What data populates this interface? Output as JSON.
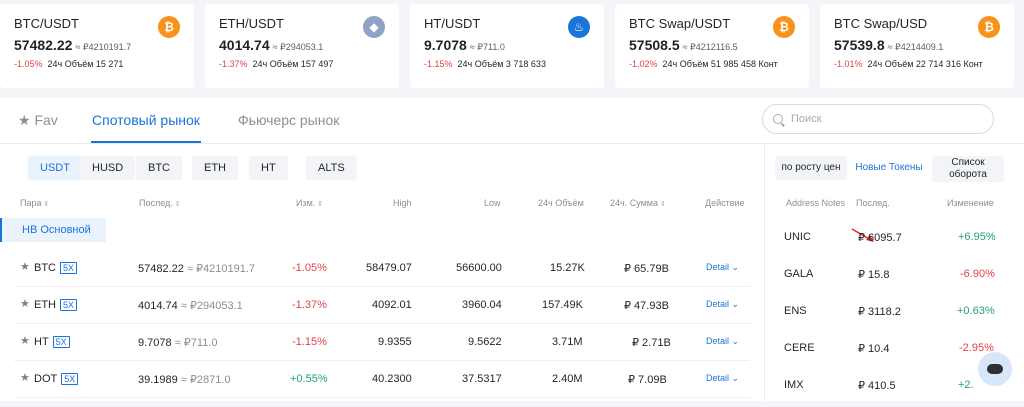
{
  "tickers": [
    {
      "pair": "BTC/USDT",
      "price": "57482.22",
      "conv": "≈ ₽4210191.7",
      "change": "-1.05%",
      "volume": "24ч Объём 15 271",
      "coin": "btc-icon",
      "coin_color": "#f7931a"
    },
    {
      "pair": "ETH/USDT",
      "price": "4014.74",
      "conv": "≈ ₽294053.1",
      "change": "-1.37%",
      "volume": "24ч Объём 157 497",
      "coin": "eth-icon",
      "coin_color": "#8fa3c8"
    },
    {
      "pair": "HT/USDT",
      "price": "9.7078",
      "conv": "≈ ₽711.0",
      "change": "-1.15%",
      "volume": "24ч Объём 3 718 633",
      "coin": "ht-icon",
      "coin_color": "#1a75d8"
    },
    {
      "pair": "BTC Swap/USDT",
      "price": "57508.5",
      "conv": "≈ ₽4212116.5",
      "change": "-1.02%",
      "volume": "24ч Объём 51 985 458 Конт",
      "coin": "btc-icon",
      "coin_color": "#f7931a"
    },
    {
      "pair": "BTC Swap/USD",
      "price": "57539.8",
      "conv": "≈ ₽4214409.1",
      "change": "-1.01%",
      "volume": "24ч Объём 22 714 316 Конт",
      "coin": "btc-icon",
      "coin_color": "#f7931a"
    }
  ],
  "tabs": {
    "fav": "Fav",
    "spot": "Спотовый рынок",
    "futures": "Фьючерс рынок"
  },
  "search": {
    "placeholder": "Поиск"
  },
  "filters": [
    "USDT",
    "HUSD",
    "BTC",
    "ETH",
    "HT",
    "ALTS"
  ],
  "table": {
    "headers": {
      "pair": "Пара",
      "last": "Послед.",
      "change": "Изм.",
      "high": "High",
      "low": "Low",
      "volume": "24ч Объём",
      "sum": "24ч. Сумма",
      "action": "Действие"
    },
    "group_tag": "HB Основной",
    "rows": [
      {
        "coin": "BTC",
        "lev": "5X",
        "last": "57482.22",
        "conv": "≈ ₽4210191.7",
        "change": "-1.05%",
        "high": "58479.07",
        "low": "56600.00",
        "volume": "15.27K",
        "sum": "₽ 65.79B",
        "action": "Detail ⌄"
      },
      {
        "coin": "ETH",
        "lev": "5X",
        "last": "4014.74",
        "conv": "≈ ₽294053.1",
        "change": "-1.37%",
        "high": "4092.01",
        "low": "3960.04",
        "volume": "157.49K",
        "sum": "₽ 47.93B",
        "action": "Detail ⌄"
      },
      {
        "coin": "HT",
        "lev": "5X",
        "last": "9.7078",
        "conv": "≈ ₽711.0",
        "change": "-1.15%",
        "high": "9.9355",
        "low": "9.5622",
        "volume": "3.71M",
        "sum": "₽ 2.71B",
        "action": "Detail ⌄"
      },
      {
        "coin": "DOT",
        "lev": "5X",
        "last": "39.1989",
        "conv": "≈ ₽2871.0",
        "change": "+0.55%",
        "high": "40.2300",
        "low": "37.5317",
        "volume": "2.40M",
        "sum": "₽ 7.09B",
        "action": "Detail ⌄"
      }
    ]
  },
  "right": {
    "buttons": [
      "по росту цен",
      "Новые Токены",
      "Список оборота"
    ],
    "headers": {
      "notes": "Address Notes",
      "last": "Послед.",
      "change": "Изменение"
    },
    "rows": [
      {
        "name": "UNIC",
        "price": "₽ 6095.7",
        "change": "+6.95%"
      },
      {
        "name": "GALA",
        "price": "₽ 15.8",
        "change": "-6.90%"
      },
      {
        "name": "ENS",
        "price": "₽ 3118.2",
        "change": "+0.63%"
      },
      {
        "name": "CERE",
        "price": "₽ 10.4",
        "change": "-2.95%"
      },
      {
        "name": "IMX",
        "price": "₽ 410.5",
        "change": "+2."
      }
    ]
  },
  "colors": {
    "accent": "#1a75d8",
    "negative": "#e0424a",
    "positive": "#23a26d"
  }
}
